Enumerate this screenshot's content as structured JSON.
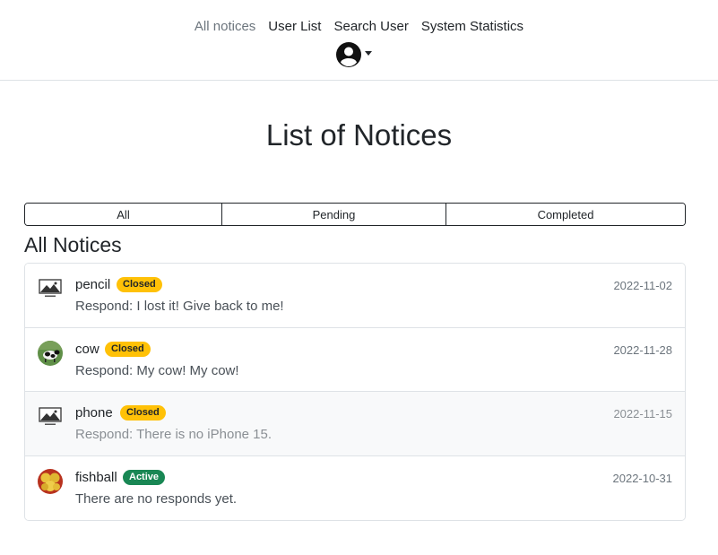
{
  "nav": {
    "links": [
      {
        "label": "All notices",
        "active": true
      },
      {
        "label": "User List",
        "active": false
      },
      {
        "label": "Search User",
        "active": false
      },
      {
        "label": "System Statistics",
        "active": false
      }
    ],
    "profile_icon": "user-circle-icon"
  },
  "page_title": "List of Notices",
  "filters": [
    "All",
    "Pending",
    "Completed"
  ],
  "section_title": "All Notices",
  "notices": [
    {
      "name": "pencil",
      "status": "Closed",
      "date": "2022-11-02",
      "respond": "Respond: I lost it! Give back to me!",
      "thumbnail": "no-image-icon"
    },
    {
      "name": "cow",
      "status": "Closed",
      "date": "2022-11-28",
      "respond": "Respond: My cow! My cow!",
      "thumbnail": "cow-photo"
    },
    {
      "name": "phone",
      "status": "Closed",
      "date": "2022-11-15",
      "respond": "Respond: There is no iPhone 15.",
      "thumbnail": "no-image-icon"
    },
    {
      "name": "fishball",
      "status": "Active",
      "date": "2022-10-31",
      "respond": "There are no responds yet.",
      "thumbnail": "fishball-photo"
    }
  ],
  "colors": {
    "closed_badge": "#ffc107",
    "active_badge": "#198754",
    "nav_active": "#6c757d",
    "border": "#dee2e6"
  }
}
